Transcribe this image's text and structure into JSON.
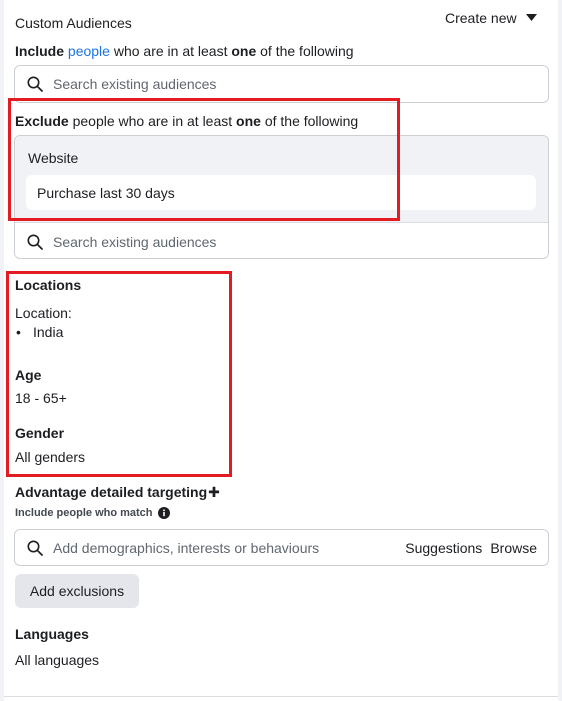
{
  "custom_audiences": {
    "heading": "Custom Audiences",
    "create_new_label": "Create new",
    "include_prefix": "Include",
    "include_link": "people",
    "include_middle": "who are in at least",
    "include_bold": "one",
    "include_suffix": "of the following",
    "search_placeholder": "Search existing audiences",
    "exclude_prefix": "Exclude",
    "exclude_middle": "people who are in at least",
    "exclude_bold": "one",
    "exclude_suffix": "of the following",
    "excluded_group_label": "Website",
    "excluded_audience": "Purchase last 30 days",
    "exclude_search_placeholder": "Search existing audiences"
  },
  "locations": {
    "heading": "Locations",
    "label": "Location:",
    "bullet": "•",
    "items": [
      "India"
    ]
  },
  "age": {
    "heading": "Age",
    "value": "18 - 65+"
  },
  "gender": {
    "heading": "Gender",
    "value": "All genders"
  },
  "detailed_targeting": {
    "heading": "Advantage detailed targeting",
    "plus_glyph": "✚",
    "sublabel": "Include people who match",
    "search_placeholder": "Add demographics, interests or behaviours",
    "suggestions_label": "Suggestions",
    "browse_label": "Browse",
    "add_exclusions_label": "Add exclusions"
  },
  "languages": {
    "heading": "Languages",
    "value": "All languages"
  },
  "colors": {
    "highlight_border": "#e31b23",
    "link_blue": "#1b74e4",
    "excluded_group_bg": "#f0f2f5",
    "button_grey": "#e4e6eb"
  }
}
